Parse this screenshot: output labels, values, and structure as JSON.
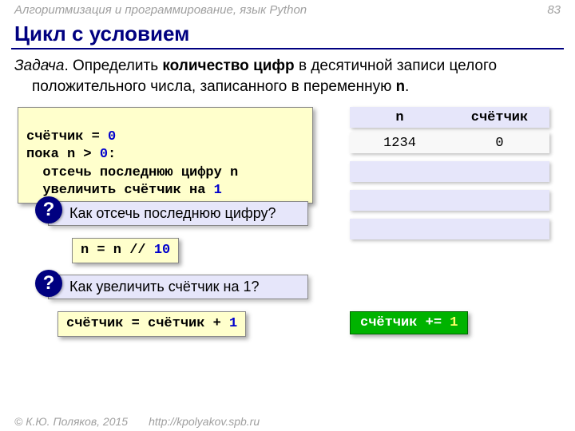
{
  "header": {
    "course": "Алгоритмизация и программирование, язык Python",
    "page": "83"
  },
  "title": "Цикл с условием",
  "task": {
    "lead": "Задача",
    "rest1": ". Определить ",
    "bold": "количество цифр",
    "rest2": " в десятичной записи целого положительного числа, записанного в переменную ",
    "var": "n",
    "rest3": "."
  },
  "code": {
    "l1a": "счётчик = ",
    "l1b": "0",
    "l2a": "пока n > ",
    "l2b": "0",
    "l2c": ":",
    "l3": "  отсечь последнюю цифру n",
    "l4a": "  увеличить счётчик на ",
    "l4b": "1"
  },
  "table": {
    "h1": "n",
    "h2": "счётчик",
    "r1c1": "1234",
    "r1c2": "0"
  },
  "q1": {
    "mark": "?",
    "text": "Как отсечь последнюю цифру?"
  },
  "q2": {
    "mark": "?",
    "text": "Как увеличить счётчик на 1?"
  },
  "ans1": {
    "a": "n = n // ",
    "b": "10"
  },
  "ans2": {
    "a": "счётчик = счётчик + ",
    "b": "1"
  },
  "ans3": {
    "a": "счётчик += ",
    "b": "1"
  },
  "footer": {
    "copy": "© К.Ю. Поляков, 2015",
    "url": "http://kpolyakov.spb.ru"
  }
}
